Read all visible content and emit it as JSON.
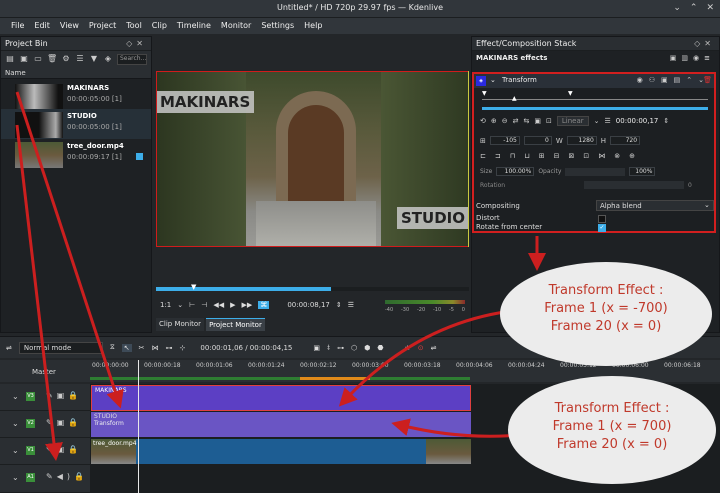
{
  "window": {
    "title": "Untitled* / HD 720p 29.97 fps — Kdenlive"
  },
  "menu": [
    "File",
    "Edit",
    "View",
    "Project",
    "Tool",
    "Clip",
    "Timeline",
    "Monitor",
    "Settings",
    "Help"
  ],
  "project_bin": {
    "title": "Project Bin",
    "search_placeholder": "Search...",
    "column": "Name",
    "items": [
      {
        "name": "MAKINARS",
        "duration": "00:00:05:00 [1]"
      },
      {
        "name": "STUDIO",
        "duration": "00:00:05:00 [1]"
      },
      {
        "name": "tree_door.mp4",
        "duration": "00:00:09:17 [1]"
      }
    ]
  },
  "monitor": {
    "overlay_top": "MAKINARS",
    "overlay_bottom": "STUDIO",
    "zoom": "1:1",
    "timecode": "00:00:08,17",
    "meter_labels": [
      "-40",
      "-30",
      "-20",
      "-10",
      "-5",
      "0"
    ],
    "tabs": [
      "Clip Monitor",
      "Project Monitor"
    ]
  },
  "effect_stack": {
    "title": "Effect/Composition Stack",
    "clip_effects": "MAKINARS effects",
    "effect_name": "Transform",
    "interp": "Linear",
    "timecode": "00:00:00,17",
    "x": "-105",
    "y": "0",
    "w": "1280",
    "h": "720",
    "size_label": "Size",
    "size_value": "100.00%",
    "opacity_label": "Opacity",
    "opacity_value": "100%",
    "rotation_label": "Rotation",
    "rotation_value": "0",
    "compositing_label": "Compositing",
    "compositing_value": "Alpha blend",
    "distort_label": "Distort",
    "rotate_label": "Rotate from center"
  },
  "timeline_toolbar": {
    "mode": "Normal mode",
    "timecode": "00:00:01,06 / 00:00:04,15"
  },
  "timeline": {
    "master": "Master",
    "ruler": [
      "00:00:00:00",
      "00:00:00:18",
      "00:00:01:06",
      "00:00:01:24",
      "00:00:02:12",
      "00:00:03:00",
      "00:00:03:18",
      "00:00:04:06",
      "00:00:04:24",
      "00:00:05:12",
      "00:00:06:00",
      "00:00:06:18"
    ],
    "clips": [
      {
        "name": "MAKINARS",
        "sub": ""
      },
      {
        "name": "STUDIO",
        "sub": "Transform"
      },
      {
        "name": "tree_door.mp4",
        "sub": ""
      }
    ],
    "track_badges": [
      "V3",
      "V2",
      "V1",
      "A1"
    ]
  },
  "annotations": {
    "top": [
      "Transform Effect :",
      "Frame 1 (x = -700)",
      "Frame 20 (x = 0)"
    ],
    "bottom": [
      "Transform Effect :",
      "Frame 1 (x = 700)",
      "Frame 20 (x = 0)"
    ]
  },
  "colors": {
    "accent": "#3daee9",
    "annotation_red": "#cc1f1f",
    "clip_purple": "#5c3fc4",
    "clip_blue": "#1d5d93"
  }
}
